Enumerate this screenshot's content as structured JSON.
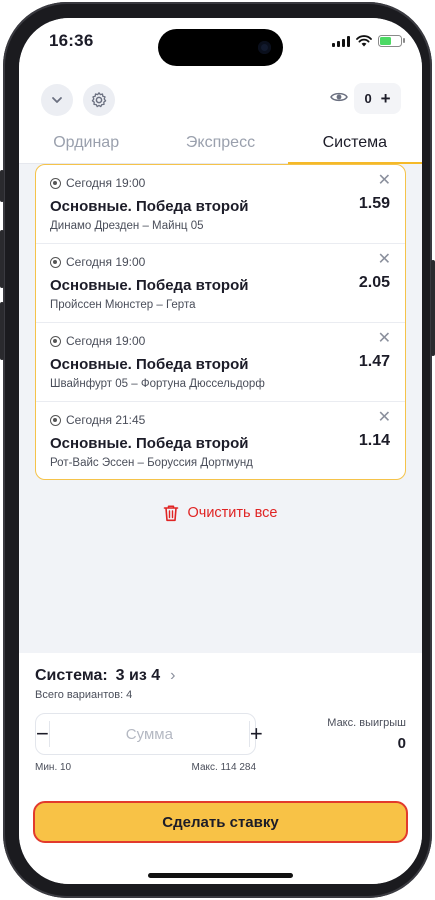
{
  "status_bar": {
    "time": "16:36"
  },
  "header": {
    "icons": {
      "collapse": "chevron-down-icon",
      "settings": "gear-icon",
      "visibility": "eye-icon"
    },
    "counter": "0",
    "counter_plus": "+"
  },
  "tabs": [
    {
      "label": "Ординар",
      "active": false
    },
    {
      "label": "Экспресс",
      "active": false
    },
    {
      "label": "Система",
      "active": true
    }
  ],
  "bets": [
    {
      "time": "Сегодня 19:00",
      "title": "Основные. Победа второй",
      "match": "Динамо Дрезден – Майнц 05",
      "odds": "1.59"
    },
    {
      "time": "Сегодня 19:00",
      "title": "Основные. Победа второй",
      "match": "Пройссен Мюнстер – Герта",
      "odds": "2.05"
    },
    {
      "time": "Сегодня 19:00",
      "title": "Основные. Победа второй",
      "match": "Швайнфурт 05 – Фортуна Дюссельдорф",
      "odds": "1.47"
    },
    {
      "time": "Сегодня 21:45",
      "title": "Основные. Победа второй",
      "match": "Рот-Вайс Эссен – Боруссия Дортмунд",
      "odds": "1.14"
    }
  ],
  "clear_all": "Очистить все",
  "system": {
    "label": "Система:",
    "value": "3 из 4",
    "variants": "Всего вариантов: 4"
  },
  "stake": {
    "minus": "−",
    "plus": "+",
    "placeholder": "Сумма",
    "value": "",
    "min": "Мин. 10",
    "max": "Макс. 114 284"
  },
  "max_win": {
    "label": "Макс. выигрыш",
    "value": "0"
  },
  "place_bet": "Сделать ставку",
  "colors": {
    "accent": "#f5b928",
    "button": "#f8c246",
    "button_border": "#e23a2c",
    "danger": "#e02424"
  }
}
